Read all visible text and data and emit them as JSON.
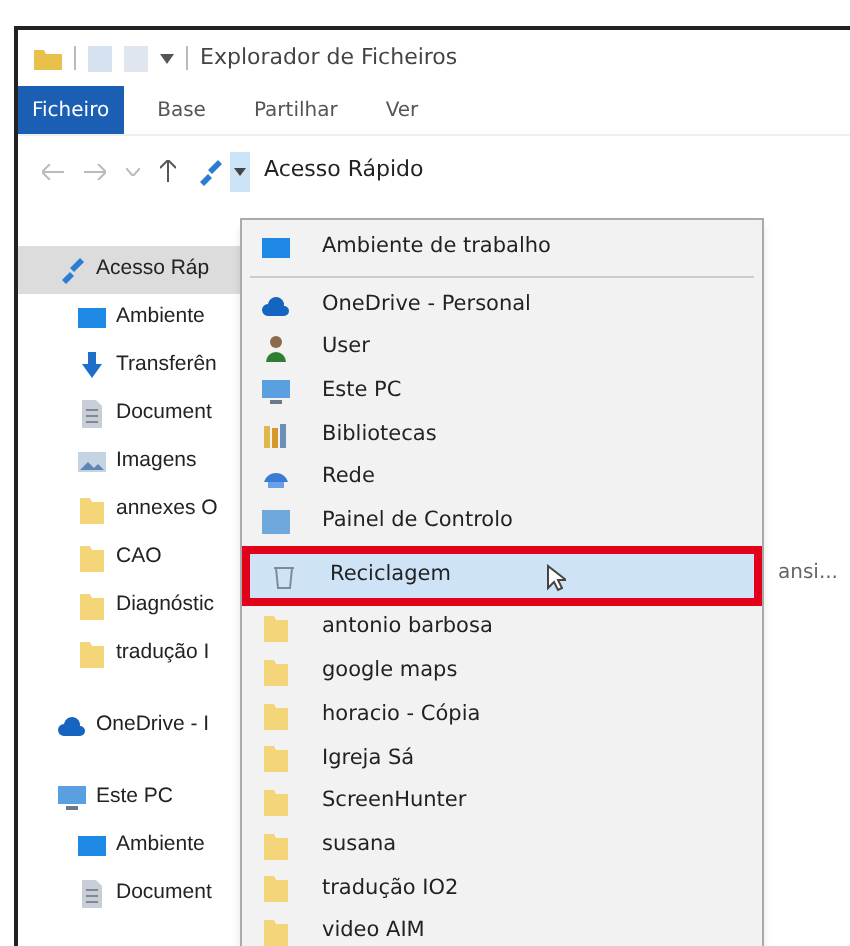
{
  "window": {
    "title": "Explorador de Ficheiros"
  },
  "ribbon_tabs": [
    {
      "label": "Ficheiro",
      "selected": true
    },
    {
      "label": "Base",
      "selected": false
    },
    {
      "label": "Partilhar",
      "selected": false
    },
    {
      "label": "Ver",
      "selected": false
    }
  ],
  "address_bar": {
    "path": "Acesso Rápido",
    "dropdown_open": true
  },
  "sidebar": {
    "items": [
      {
        "label": "Acesso Ráp",
        "kind": "star",
        "selected": true,
        "children": [
          {
            "label": "Ambiente",
            "kind": "desktop",
            "selected": false
          },
          {
            "label": "Transferên",
            "kind": "download",
            "selected": false
          },
          {
            "label": "Document",
            "kind": "document",
            "selected": false
          },
          {
            "label": "Imagens",
            "kind": "images",
            "selected": false
          },
          {
            "label": "annexes O",
            "kind": "folder",
            "selected": false
          },
          {
            "label": "CAO",
            "kind": "folder",
            "selected": false
          },
          {
            "label": "Diagnóstic",
            "kind": "folder",
            "selected": false
          },
          {
            "label": "tradução I",
            "kind": "folder",
            "selected": false
          }
        ]
      },
      {
        "label": "OneDrive - I",
        "kind": "cloud",
        "selected": false
      },
      {
        "label": "Este PC",
        "kind": "pc",
        "selected": false,
        "children": [
          {
            "label": "Ambiente",
            "kind": "desktop",
            "selected": false
          },
          {
            "label": "Document",
            "kind": "document",
            "selected": false
          }
        ]
      }
    ]
  },
  "background_text": "ansi...",
  "dropdown_menu": {
    "items": [
      {
        "label": "Ambiente de trabalho",
        "kind": "desktop",
        "selected": false
      },
      {
        "kind": "separator"
      },
      {
        "label": "OneDrive - Personal",
        "kind": "cloud",
        "selected": false
      },
      {
        "label": "User",
        "kind": "user",
        "selected": false
      },
      {
        "label": "Este PC",
        "kind": "pc",
        "selected": false
      },
      {
        "label": "Bibliotecas",
        "kind": "library",
        "selected": false
      },
      {
        "label": "Rede",
        "kind": "network",
        "selected": false
      },
      {
        "label": "Painel de Controlo",
        "kind": "control",
        "selected": false
      },
      {
        "label": "Reciclagem",
        "kind": "recycle",
        "selected": true,
        "highlighted_with_red_box": true
      },
      {
        "label": "antonio barbosa",
        "kind": "folder",
        "selected": false
      },
      {
        "label": "google maps",
        "kind": "folder",
        "selected": false
      },
      {
        "label": "horacio - Cópia",
        "kind": "folder",
        "selected": false
      },
      {
        "label": "Igreja Sá",
        "kind": "folder",
        "selected": false
      },
      {
        "label": "ScreenHunter",
        "kind": "folder",
        "selected": false
      },
      {
        "label": "susana",
        "kind": "folder",
        "selected": false
      },
      {
        "label": "tradução IO2",
        "kind": "folder",
        "selected": false
      },
      {
        "label": "video AIM",
        "kind": "folder",
        "selected": false
      }
    ]
  }
}
